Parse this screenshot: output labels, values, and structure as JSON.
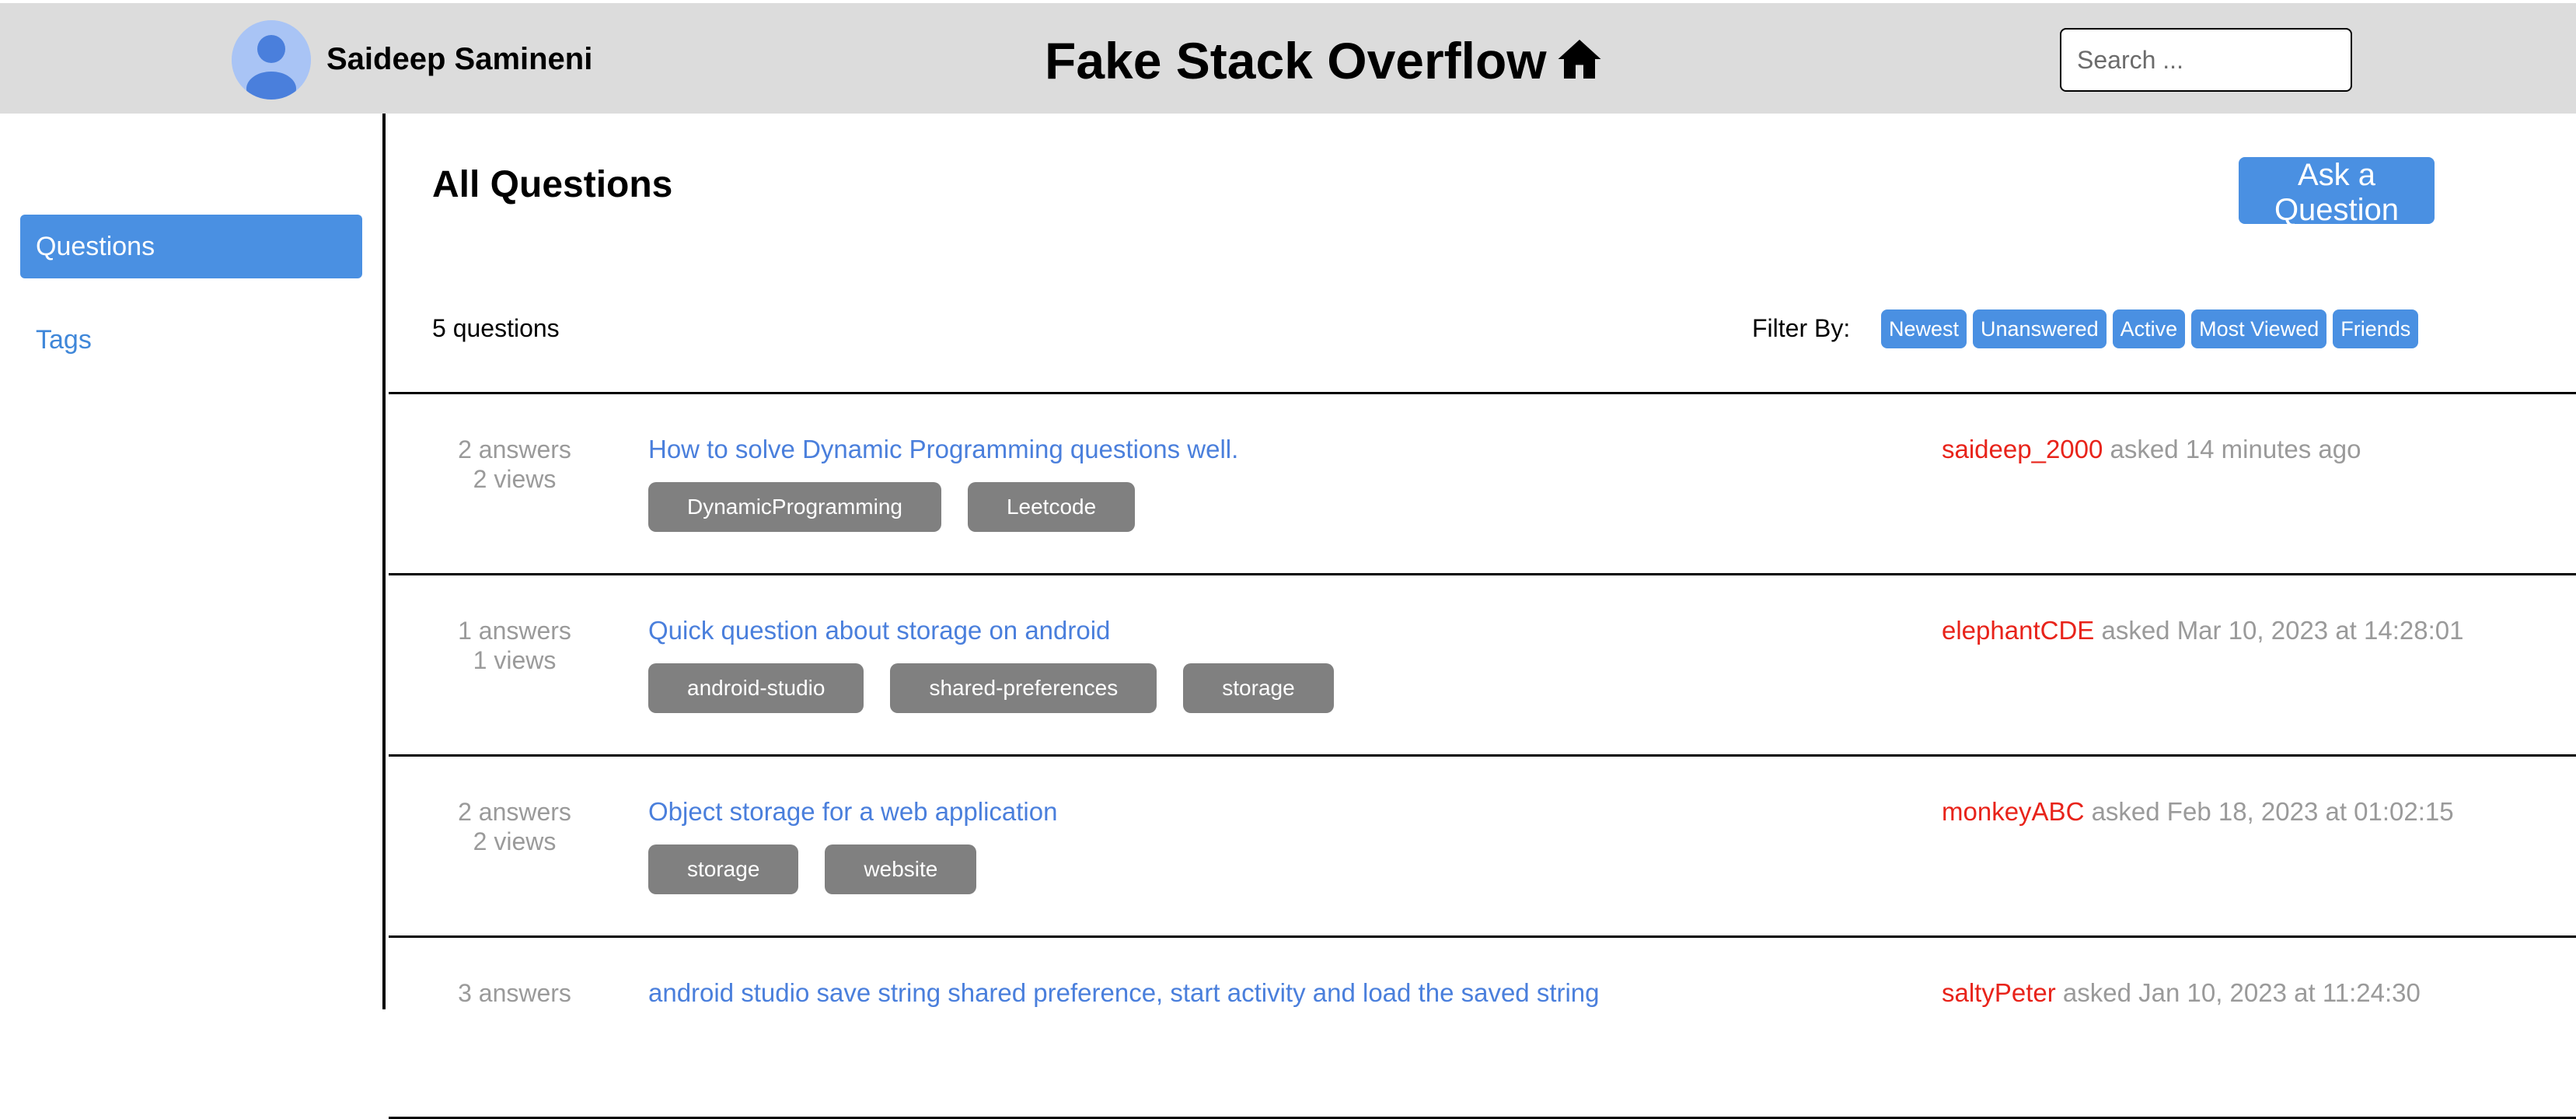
{
  "header": {
    "user_name": "Saideep Samineni",
    "title": "Fake Stack Overflow",
    "search_placeholder": "Search ...",
    "home_icon": "home-icon"
  },
  "sidebar": {
    "items": [
      {
        "label": "Questions",
        "active": true
      },
      {
        "label": "Tags",
        "active": false
      }
    ]
  },
  "main": {
    "title": "All Questions",
    "ask_button": "Ask a Question",
    "question_count": "5 questions",
    "filter_label": "Filter By:",
    "filters": [
      "Newest",
      "Unanswered",
      "Active",
      "Most Viewed",
      "Friends"
    ]
  },
  "questions": [
    {
      "answers": "2 answers",
      "views": "2 views",
      "title": "How to solve Dynamic Programming questions well.",
      "tags": [
        "DynamicProgramming",
        "Leetcode"
      ],
      "user": "saideep_2000",
      "asked": "asked 14 minutes ago"
    },
    {
      "answers": "1 answers",
      "views": "1 views",
      "title": "Quick question about storage on android",
      "tags": [
        "android-studio",
        "shared-preferences",
        "storage"
      ],
      "user": "elephantCDE",
      "asked": "asked Mar 10, 2023 at 14:28:01"
    },
    {
      "answers": "2 answers",
      "views": "2 views",
      "title": "Object storage for a web application",
      "tags": [
        "storage",
        "website"
      ],
      "user": "monkeyABC",
      "asked": "asked Feb 18, 2023 at 01:02:15"
    },
    {
      "answers": "3 answers",
      "views": "",
      "title": "android studio save string shared preference, start activity and load the saved string",
      "tags": [],
      "user": "saltyPeter",
      "asked": "asked Jan 10, 2023 at 11:24:30"
    }
  ],
  "colors": {
    "header_bg": "#dcdcdc",
    "accent": "#4a90e2",
    "title_link": "#4a7fdc",
    "tag_bg": "#808080",
    "user_red": "#e8231a",
    "muted": "#9a9a9a"
  }
}
